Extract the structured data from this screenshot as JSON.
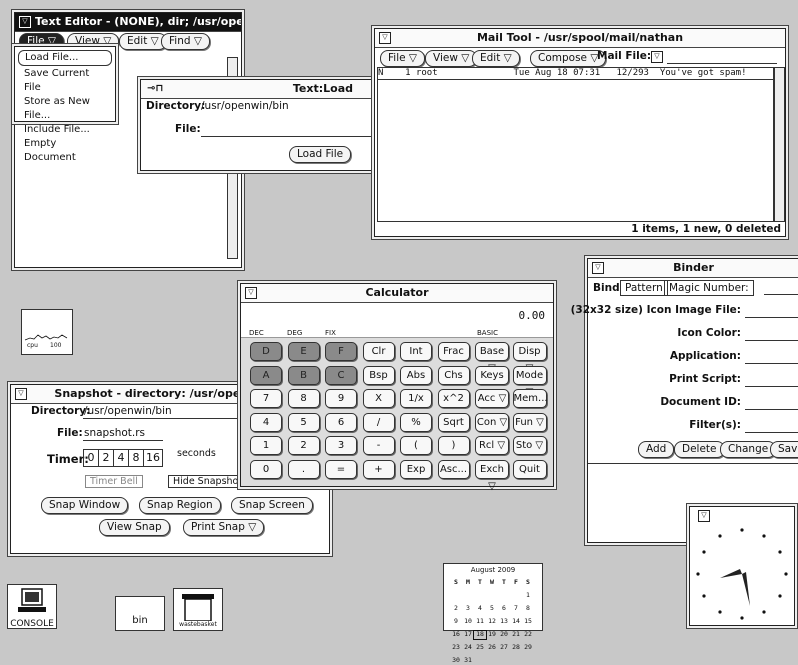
{
  "text_editor": {
    "title": "Text Editor - (NONE), dir; /usr/openwin/bi",
    "menus": [
      "File",
      "View",
      "Edit",
      "Find"
    ],
    "file_menu": [
      "Load File...",
      "Save Current File",
      "Store as New File...",
      "Include File...",
      "Empty Document"
    ]
  },
  "textload": {
    "title": "Text:Load",
    "dir_label": "Directory:",
    "dir_value": "/usr/openwin/bin",
    "file_label": "File:",
    "load_btn": "Load File"
  },
  "mail": {
    "title": "Mail Tool - /usr/spool/mail/nathan",
    "buttons": [
      "File",
      "View",
      "Edit",
      "Compose"
    ],
    "mailfile_label": "Mail File:",
    "row": {
      "flag": "N",
      "num": "1",
      "from": "root",
      "date": "Tue Aug 18 07:31",
      "size": "12/293",
      "subject": "You've got spam!"
    },
    "status": "1 items, 1 new, 0 deleted"
  },
  "calc": {
    "title": "Calculator",
    "display": "0.00",
    "modes": [
      "DEC",
      "DEG",
      "FIX",
      "BASIC"
    ],
    "keys": [
      [
        "D",
        "E",
        "F",
        "Clr",
        "Int",
        "Frac",
        "Base ▽",
        "Disp ▽"
      ],
      [
        "A",
        "B",
        "C",
        "Bsp",
        "Abs",
        "Chs",
        "Keys",
        "Mode ▽"
      ],
      [
        "7",
        "8",
        "9",
        "X",
        "1/x",
        "x^2",
        "Acc ▽",
        "Mem..."
      ],
      [
        "4",
        "5",
        "6",
        "/",
        "%",
        "Sqrt",
        "Con ▽",
        "Fun ▽"
      ],
      [
        "1",
        "2",
        "3",
        "-",
        "(",
        ")",
        "Rcl ▽",
        "Sto ▽"
      ],
      [
        "0",
        ".",
        "=",
        "+",
        "Exp",
        "Asc...",
        "Exch ▽",
        "Quit"
      ]
    ]
  },
  "binder": {
    "title": "Binder",
    "bind_label": "Bind",
    "tabs": [
      "Pattern",
      "Magic Number:"
    ],
    "fields": [
      "(32x32 size) Icon Image File:",
      "Icon Color:",
      "Application:",
      "Print Script:",
      "Document ID:",
      "Filter(s):"
    ],
    "buttons": [
      "Add",
      "Delete",
      "Change",
      "Save"
    ]
  },
  "snapshot": {
    "title": "Snapshot - directory: /usr/openwin/bi",
    "dir_label": "Directory:",
    "dir_value": "/usr/openwin/bin",
    "file_label": "File:",
    "file_value": "snapshot.rs",
    "timer_label": "Timer:",
    "timer_values": [
      "0",
      "2",
      "4",
      "8",
      "16"
    ],
    "seconds": "seconds",
    "timer_bell": "Timer Bell",
    "hide": "Hide Snapshot D",
    "buttons": [
      "Snap Window",
      "Snap Region",
      "Snap Screen"
    ],
    "buttons2": [
      "View Snap",
      "Print Snap ▽"
    ]
  },
  "perfmeter": {
    "label1": "cpu",
    "label2": "100"
  },
  "desktop": {
    "console": "CONSOLE",
    "bin": "bin",
    "wastebasket": "wastebasket"
  },
  "calendar": {
    "title": "August 2009",
    "days": [
      "S",
      "M",
      "T",
      "W",
      "T",
      "F",
      "S"
    ],
    "rows": [
      [
        "",
        "",
        "",
        "",
        "",
        "",
        "1"
      ],
      [
        "2",
        "3",
        "4",
        "5",
        "6",
        "7",
        "8"
      ],
      [
        "9",
        "10",
        "11",
        "12",
        "13",
        "14",
        "15"
      ],
      [
        "16",
        "17",
        "18",
        "19",
        "20",
        "21",
        "22"
      ],
      [
        "23",
        "24",
        "25",
        "26",
        "27",
        "28",
        "29"
      ],
      [
        "30",
        "31",
        "",
        "",
        "",
        "",
        ""
      ]
    ]
  }
}
